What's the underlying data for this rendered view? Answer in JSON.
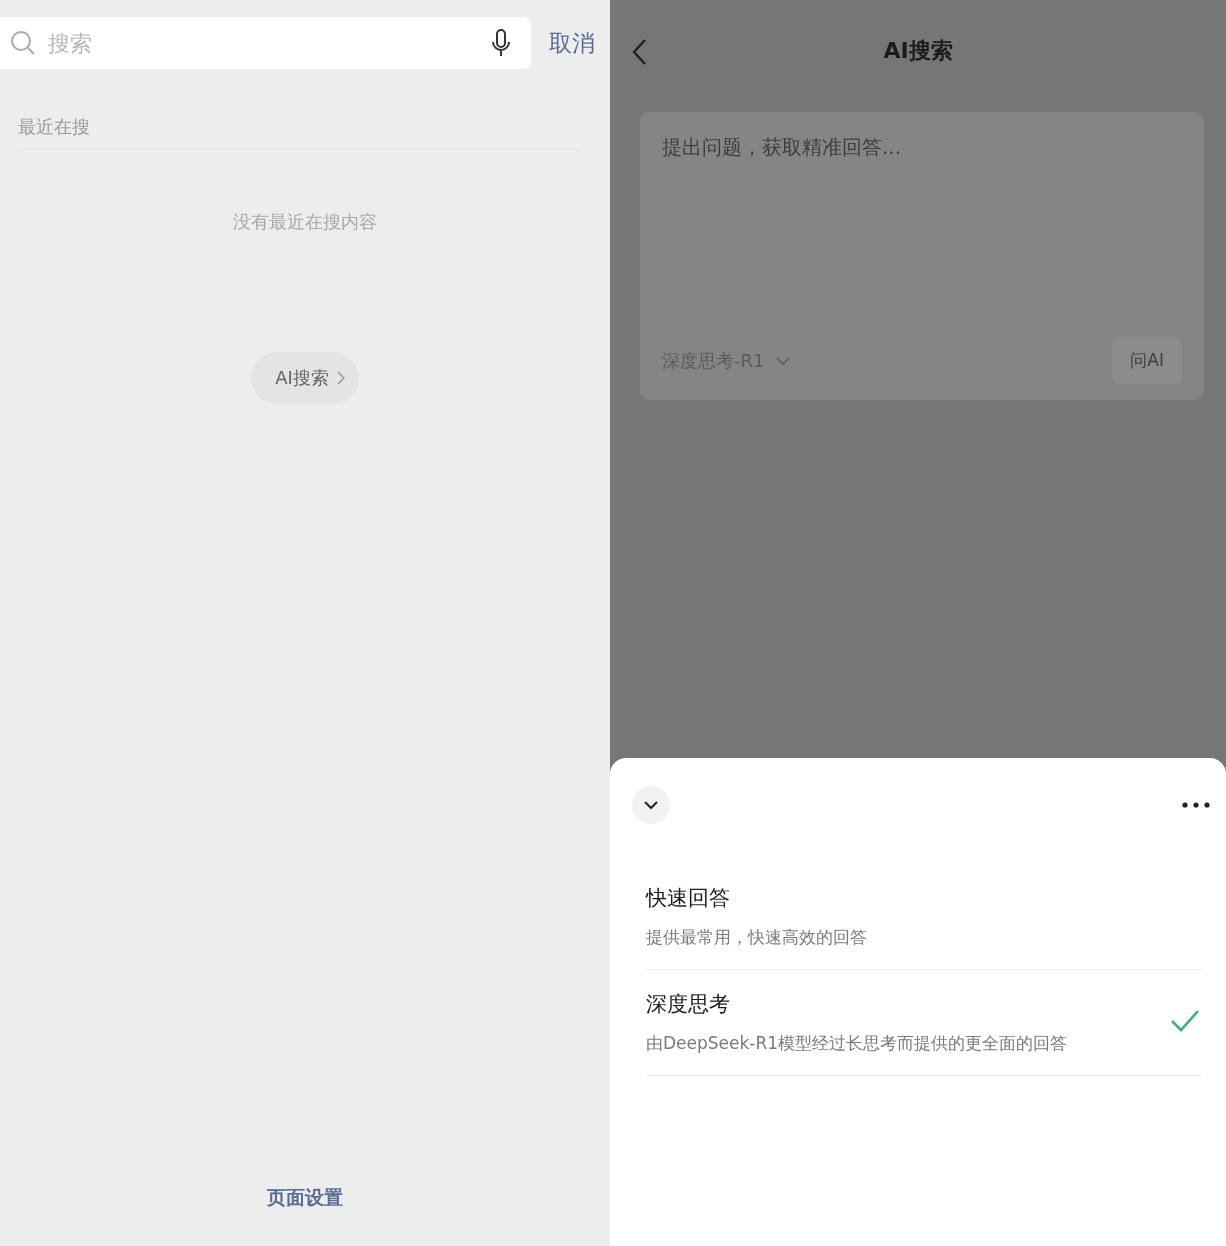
{
  "search": {
    "placeholder": "搜索",
    "cancel": "取消"
  },
  "recent": {
    "title": "最近在搜",
    "empty": "没有最近在搜内容"
  },
  "ai_entry": {
    "label": "AI搜索"
  },
  "footer_link": "页面设置",
  "ai_page": {
    "title": "AI搜索",
    "input": {
      "placeholder": "提出问题，获取精准回答..."
    },
    "model": "深度思考-R1",
    "ask_button": "问AI"
  },
  "sheet": {
    "options": [
      {
        "title": "快速回答",
        "description": "提供最常用，快速高效的回答",
        "selected": false
      },
      {
        "title": "深度思考",
        "description": "由DeepSeek-R1模型经过长思考而提供的更全面的回答",
        "selected": true
      }
    ]
  }
}
